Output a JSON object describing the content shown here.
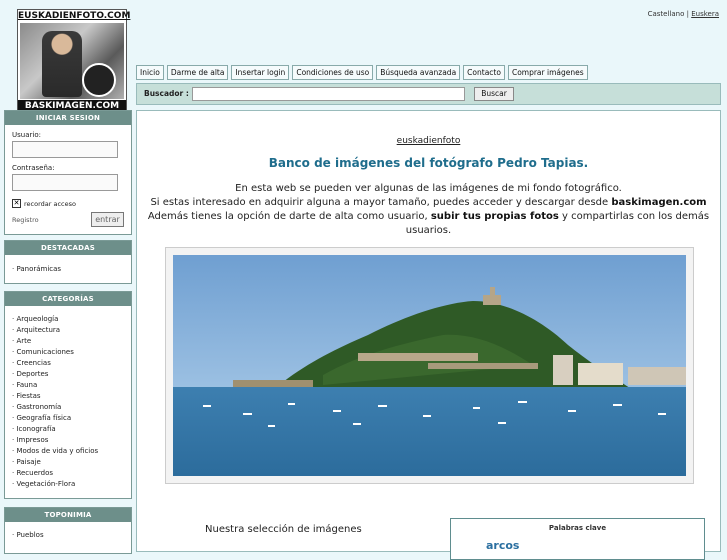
{
  "logo": {
    "top_text": "EUSKADIENFOTO.COM",
    "bottom_text": "BASKIMAGEN.COM"
  },
  "lang": {
    "first": "Castellano",
    "separator": "|",
    "second": "Euskera"
  },
  "nav": [
    "Inicio",
    "Darme de alta",
    "Insertar login",
    "Condiciones de uso",
    "Búsqueda avanzada",
    "Contacto",
    "Comprar imágenes"
  ],
  "search": {
    "label": "Buscador :",
    "button": "Buscar"
  },
  "login": {
    "title": "INICIAR SESION",
    "user_label": "Usuario:",
    "password_label": "Contraseña:",
    "remember": "recordar acceso",
    "register": "Registro",
    "enter": "entrar"
  },
  "featured": {
    "title": "DESTACADAS",
    "items": [
      "· Panorámicas"
    ]
  },
  "categories": {
    "title": "CATEGORÍAS",
    "items": [
      "· Arqueología",
      "· Arquitectura",
      "· Arte",
      "· Comunicaciones",
      "· Creencias",
      "· Deportes",
      "· Fauna",
      "· Fiestas",
      "· Gastronomía",
      "· Geografía física",
      "· Iconografía",
      "· Impresos",
      "· Modos de vida y oficios",
      "· Paisaje",
      "· Recuerdos",
      "· Vegetación-Flora"
    ]
  },
  "toponymy": {
    "title": "TOPONIMIA",
    "items": [
      "· Pueblos"
    ]
  },
  "main": {
    "site_link": "euskadienfoto",
    "headline": "Banco de imágenes del fotógrafo Pedro Tapias.",
    "line1": "En esta web se pueden ver algunas de las imágenes de mi fondo fotográfico.",
    "line2_a": "Si estas interesado en adquirir alguna a mayor tamaño, puedes acceder y descargar desde ",
    "line2_b": "baskimagen.com",
    "line3_a": "Además tienes la opción de darte de alta como usuario, ",
    "line3_b": "subir tus propias fotos",
    "line3_c": " y compartirlas con los demás usuarios.",
    "selection": "Nuestra selección de imágenes",
    "keywords_title": "Palabras clave",
    "keyword_1": "arcos"
  }
}
